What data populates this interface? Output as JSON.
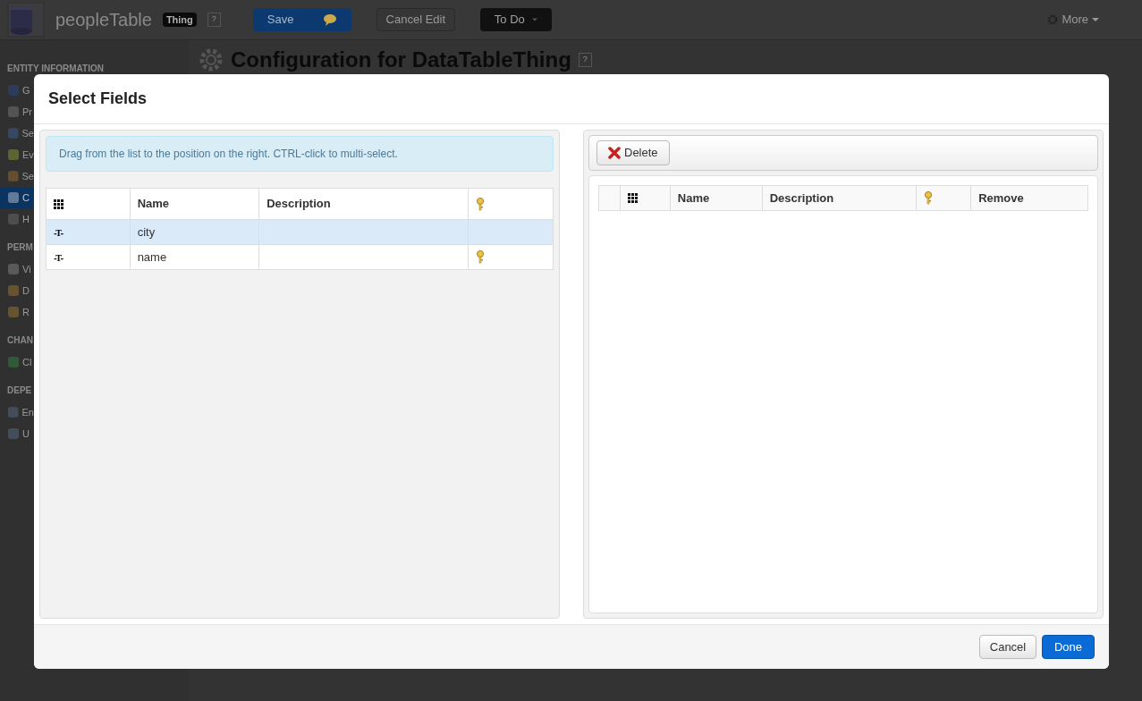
{
  "app": {
    "title": "peopleTable",
    "badge": "Thing",
    "help": "?",
    "save": "Save",
    "cancel_edit": "Cancel Edit",
    "todo": "To Do",
    "more": "More"
  },
  "sidebar": {
    "sections": [
      {
        "header": "ENTITY INFORMATION",
        "items": [
          {
            "label": "G",
            "selected": false
          },
          {
            "label": "Pr",
            "selected": false
          },
          {
            "label": "Se",
            "selected": false
          },
          {
            "label": "Ev",
            "selected": false
          },
          {
            "label": "Se",
            "selected": false
          },
          {
            "label": "C",
            "selected": true
          },
          {
            "label": "H",
            "selected": false
          }
        ]
      },
      {
        "header": "PERM",
        "items": [
          {
            "label": "Vi",
            "selected": false
          },
          {
            "label": "D",
            "selected": false
          },
          {
            "label": "R",
            "selected": false
          }
        ]
      },
      {
        "header": "CHAN",
        "items": [
          {
            "label": "Cl",
            "selected": false
          }
        ]
      },
      {
        "header": "DEPE",
        "items": [
          {
            "label": "En",
            "selected": false
          },
          {
            "label": "U",
            "selected": false
          }
        ]
      }
    ]
  },
  "page": {
    "heading": "Configuration for DataTableThing",
    "help": "?"
  },
  "dialog": {
    "title": "Select Fields",
    "hint": "Drag from the list to the position on the right. CTRL-click to multi-select.",
    "source_table": {
      "columns": [
        {
          "kind": "type"
        },
        {
          "kind": "text",
          "label": "Name"
        },
        {
          "kind": "text",
          "label": "Description"
        },
        {
          "kind": "key"
        }
      ],
      "rows": [
        {
          "type": "-T-",
          "name": "city",
          "primary_key": false,
          "selected": true
        },
        {
          "type": "-T-",
          "name": "name",
          "primary_key": true,
          "selected": false
        }
      ]
    },
    "delete": "Delete",
    "target_table": {
      "columns": [
        {
          "kind": "blank"
        },
        {
          "kind": "type"
        },
        {
          "kind": "text",
          "label": "Name"
        },
        {
          "kind": "text",
          "label": "Description"
        },
        {
          "kind": "key"
        },
        {
          "kind": "text",
          "label": "Remove"
        }
      ]
    },
    "cancel": "Cancel",
    "done": "Done"
  }
}
